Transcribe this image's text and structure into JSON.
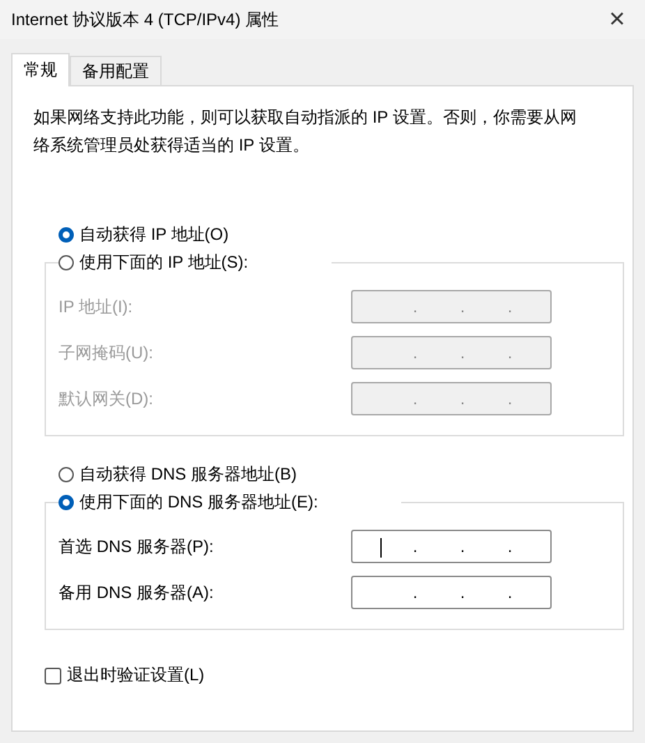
{
  "window": {
    "title": "Internet 协议版本 4 (TCP/IPv4) 属性",
    "close": "×"
  },
  "tabs": [
    {
      "label": "常规",
      "selected": true
    },
    {
      "label": "备用配置",
      "selected": false
    }
  ],
  "description": "如果网络支持此功能，则可以获取自动指派的 IP 设置。否则，你需要从网络系统管理员处获得适当的 IP 设置。",
  "ip_auto": {
    "label": "自动获得 IP 地址(O)",
    "selected": true
  },
  "ip_manual": {
    "label": "使用下面的 IP 地址(S):",
    "selected": false,
    "fields": [
      {
        "label": "IP 地址(I):",
        "dots": [
          ".",
          ".",
          "."
        ],
        "disabled": true,
        "focused": false
      },
      {
        "label": "子网掩码(U):",
        "dots": [
          ".",
          ".",
          "."
        ],
        "disabled": true,
        "focused": false
      },
      {
        "label": "默认网关(D):",
        "dots": [
          ".",
          ".",
          "."
        ],
        "disabled": true,
        "focused": false
      }
    ]
  },
  "dns_auto": {
    "label": "自动获得 DNS 服务器地址(B)",
    "selected": false
  },
  "dns_manual": {
    "label": "使用下面的 DNS 服务器地址(E):",
    "selected": true,
    "fields": [
      {
        "label": "首选 DNS 服务器(P):",
        "dots": [
          ".",
          ".",
          "."
        ],
        "disabled": false,
        "focused": true
      },
      {
        "label": "备用 DNS 服务器(A):",
        "dots": [
          ".",
          ".",
          "."
        ],
        "disabled": false,
        "focused": false
      }
    ]
  },
  "validate": {
    "label": "退出时验证设置(L)",
    "checked": false
  }
}
